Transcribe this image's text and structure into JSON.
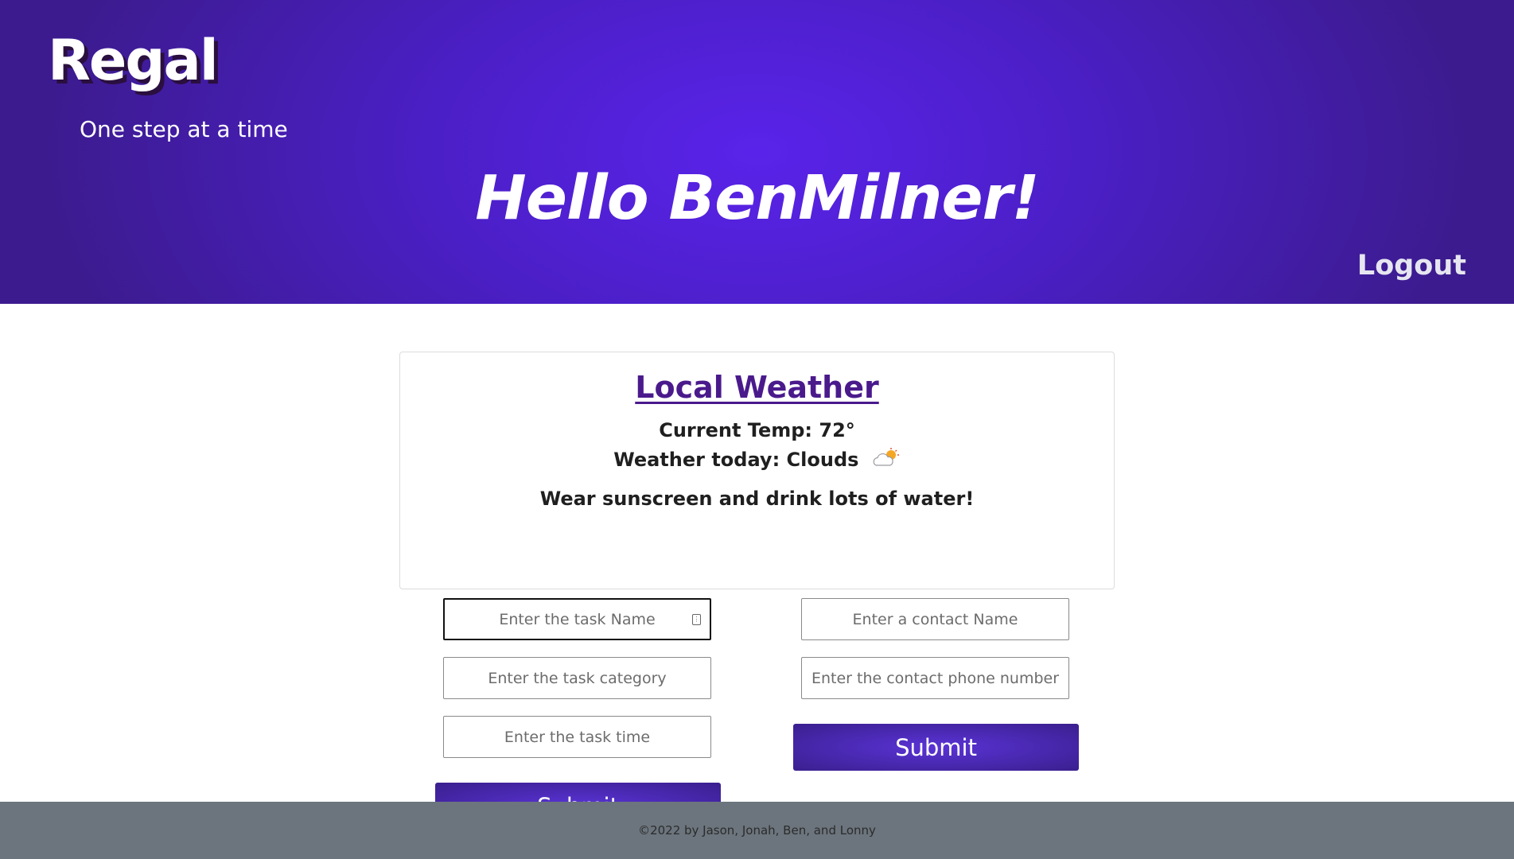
{
  "header": {
    "brand": "Regal",
    "tagline": "One step at a time",
    "greeting": "Hello BenMilner!",
    "logout_label": "Logout"
  },
  "weather": {
    "title": "Local Weather",
    "current_temp": "Current Temp: 72°",
    "conditions": "Weather today: Clouds",
    "conditions_icon": "cloud-sun-icon",
    "advice": "Wear sunscreen and drink lots of water!"
  },
  "task_form": {
    "name_placeholder": "Enter the task Name",
    "category_placeholder": "Enter the task category",
    "time_placeholder": "Enter the task time",
    "submit_label": "Submit"
  },
  "contact_form": {
    "name_placeholder": "Enter a contact Name",
    "phone_placeholder": "Enter the contact phone number",
    "submit_label": "Submit"
  },
  "footer": {
    "text": "©2022 by Jason, Jonah, Ben, and Lonny"
  },
  "colors": {
    "header_gradient_center": "#5a23ea",
    "header_gradient_edge": "#3c1b8e",
    "weather_title": "#4a1a8c",
    "footer_bg": "#6c757d"
  }
}
